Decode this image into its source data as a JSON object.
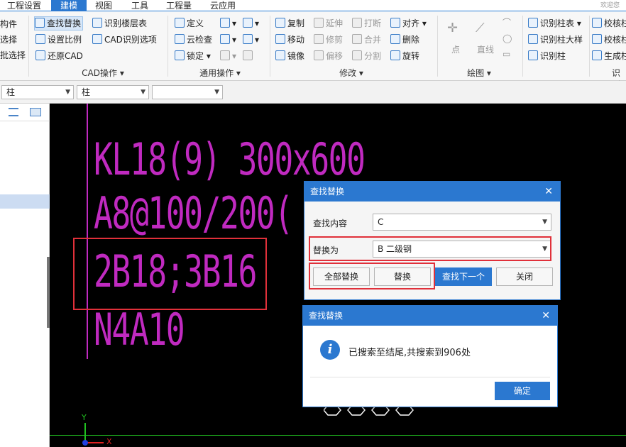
{
  "menubar": {
    "items": [
      "工程设置",
      "建模",
      "视图",
      "工具",
      "工程量",
      "云应用"
    ],
    "right_text": "欢迎您"
  },
  "ribbon": {
    "col0": [
      "构件",
      "选择",
      "批选择"
    ],
    "cad": {
      "items": [
        "查找替换",
        "设置比例",
        "还原CAD",
        "识别楼层表",
        "CAD识别选项"
      ],
      "label": "CAD操作"
    },
    "general": {
      "items": [
        "定义",
        "云检查",
        "锁定"
      ],
      "label": "通用操作"
    },
    "modify": {
      "items": [
        "复制",
        "移动",
        "镜像",
        "延伸",
        "修剪",
        "偏移",
        "打断",
        "合并",
        "分割",
        "对齐",
        "删除",
        "旋转"
      ],
      "label": "修改"
    },
    "draw": {
      "items": [
        "点",
        "直线"
      ],
      "label": "绘图"
    },
    "recognize": {
      "items": [
        "识别柱表",
        "识别柱大样",
        "识别柱",
        "校核柱",
        "校核柱",
        "生成柱"
      ],
      "label": "识别"
    }
  },
  "toolbar2": {
    "combos": [
      "柱",
      "柱",
      ""
    ]
  },
  "canvas": {
    "text_lines": [
      "KL18(9) 300x600",
      "A8@100/200(",
      "2B18;3B16",
      "N4A10"
    ],
    "axis": {
      "y": "Y",
      "x": "X"
    }
  },
  "find_replace_dialog": {
    "title": "查找替换",
    "find_label": "查找内容",
    "find_value": "C",
    "replace_label": "替换为",
    "replace_value": "B 二级钢",
    "buttons": {
      "replace_all": "全部替换",
      "replace": "替换",
      "find_next": "查找下一个",
      "close": "关闭"
    }
  },
  "info_dialog": {
    "title": "查找替换",
    "message": "已搜索至结尾,共搜索到906处",
    "ok_label": "确定"
  },
  "colors": {
    "accent": "#2b78d0",
    "cad_text": "#c02ac0",
    "highlight_box": "#e0303a",
    "canvas_bg": "#000000"
  }
}
